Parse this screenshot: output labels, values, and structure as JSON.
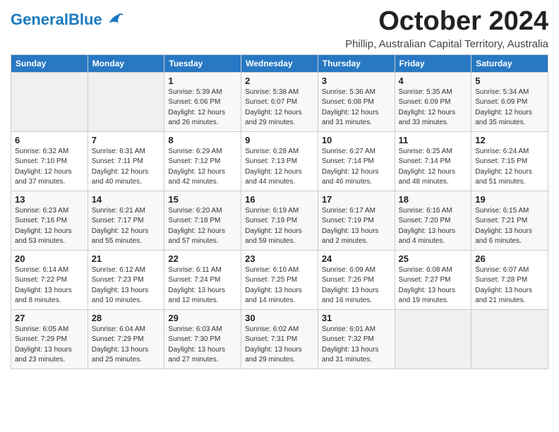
{
  "logo": {
    "text_general": "General",
    "text_blue": "Blue"
  },
  "title": "October 2024",
  "subtitle": "Phillip, Australian Capital Territory, Australia",
  "days_of_week": [
    "Sunday",
    "Monday",
    "Tuesday",
    "Wednesday",
    "Thursday",
    "Friday",
    "Saturday"
  ],
  "weeks": [
    [
      {
        "day": "",
        "sunrise": "",
        "sunset": "",
        "daylight": ""
      },
      {
        "day": "",
        "sunrise": "",
        "sunset": "",
        "daylight": ""
      },
      {
        "day": "1",
        "sunrise": "Sunrise: 5:39 AM",
        "sunset": "Sunset: 6:06 PM",
        "daylight": "Daylight: 12 hours and 26 minutes."
      },
      {
        "day": "2",
        "sunrise": "Sunrise: 5:38 AM",
        "sunset": "Sunset: 6:07 PM",
        "daylight": "Daylight: 12 hours and 29 minutes."
      },
      {
        "day": "3",
        "sunrise": "Sunrise: 5:36 AM",
        "sunset": "Sunset: 6:08 PM",
        "daylight": "Daylight: 12 hours and 31 minutes."
      },
      {
        "day": "4",
        "sunrise": "Sunrise: 5:35 AM",
        "sunset": "Sunset: 6:09 PM",
        "daylight": "Daylight: 12 hours and 33 minutes."
      },
      {
        "day": "5",
        "sunrise": "Sunrise: 5:34 AM",
        "sunset": "Sunset: 6:09 PM",
        "daylight": "Daylight: 12 hours and 35 minutes."
      }
    ],
    [
      {
        "day": "6",
        "sunrise": "Sunrise: 6:32 AM",
        "sunset": "Sunset: 7:10 PM",
        "daylight": "Daylight: 12 hours and 37 minutes."
      },
      {
        "day": "7",
        "sunrise": "Sunrise: 6:31 AM",
        "sunset": "Sunset: 7:11 PM",
        "daylight": "Daylight: 12 hours and 40 minutes."
      },
      {
        "day": "8",
        "sunrise": "Sunrise: 6:29 AM",
        "sunset": "Sunset: 7:12 PM",
        "daylight": "Daylight: 12 hours and 42 minutes."
      },
      {
        "day": "9",
        "sunrise": "Sunrise: 6:28 AM",
        "sunset": "Sunset: 7:13 PM",
        "daylight": "Daylight: 12 hours and 44 minutes."
      },
      {
        "day": "10",
        "sunrise": "Sunrise: 6:27 AM",
        "sunset": "Sunset: 7:14 PM",
        "daylight": "Daylight: 12 hours and 46 minutes."
      },
      {
        "day": "11",
        "sunrise": "Sunrise: 6:25 AM",
        "sunset": "Sunset: 7:14 PM",
        "daylight": "Daylight: 12 hours and 48 minutes."
      },
      {
        "day": "12",
        "sunrise": "Sunrise: 6:24 AM",
        "sunset": "Sunset: 7:15 PM",
        "daylight": "Daylight: 12 hours and 51 minutes."
      }
    ],
    [
      {
        "day": "13",
        "sunrise": "Sunrise: 6:23 AM",
        "sunset": "Sunset: 7:16 PM",
        "daylight": "Daylight: 12 hours and 53 minutes."
      },
      {
        "day": "14",
        "sunrise": "Sunrise: 6:21 AM",
        "sunset": "Sunset: 7:17 PM",
        "daylight": "Daylight: 12 hours and 55 minutes."
      },
      {
        "day": "15",
        "sunrise": "Sunrise: 6:20 AM",
        "sunset": "Sunset: 7:18 PM",
        "daylight": "Daylight: 12 hours and 57 minutes."
      },
      {
        "day": "16",
        "sunrise": "Sunrise: 6:19 AM",
        "sunset": "Sunset: 7:19 PM",
        "daylight": "Daylight: 12 hours and 59 minutes."
      },
      {
        "day": "17",
        "sunrise": "Sunrise: 6:17 AM",
        "sunset": "Sunset: 7:19 PM",
        "daylight": "Daylight: 13 hours and 2 minutes."
      },
      {
        "day": "18",
        "sunrise": "Sunrise: 6:16 AM",
        "sunset": "Sunset: 7:20 PM",
        "daylight": "Daylight: 13 hours and 4 minutes."
      },
      {
        "day": "19",
        "sunrise": "Sunrise: 6:15 AM",
        "sunset": "Sunset: 7:21 PM",
        "daylight": "Daylight: 13 hours and 6 minutes."
      }
    ],
    [
      {
        "day": "20",
        "sunrise": "Sunrise: 6:14 AM",
        "sunset": "Sunset: 7:22 PM",
        "daylight": "Daylight: 13 hours and 8 minutes."
      },
      {
        "day": "21",
        "sunrise": "Sunrise: 6:12 AM",
        "sunset": "Sunset: 7:23 PM",
        "daylight": "Daylight: 13 hours and 10 minutes."
      },
      {
        "day": "22",
        "sunrise": "Sunrise: 6:11 AM",
        "sunset": "Sunset: 7:24 PM",
        "daylight": "Daylight: 13 hours and 12 minutes."
      },
      {
        "day": "23",
        "sunrise": "Sunrise: 6:10 AM",
        "sunset": "Sunset: 7:25 PM",
        "daylight": "Daylight: 13 hours and 14 minutes."
      },
      {
        "day": "24",
        "sunrise": "Sunrise: 6:09 AM",
        "sunset": "Sunset: 7:26 PM",
        "daylight": "Daylight: 13 hours and 16 minutes."
      },
      {
        "day": "25",
        "sunrise": "Sunrise: 6:08 AM",
        "sunset": "Sunset: 7:27 PM",
        "daylight": "Daylight: 13 hours and 19 minutes."
      },
      {
        "day": "26",
        "sunrise": "Sunrise: 6:07 AM",
        "sunset": "Sunset: 7:28 PM",
        "daylight": "Daylight: 13 hours and 21 minutes."
      }
    ],
    [
      {
        "day": "27",
        "sunrise": "Sunrise: 6:05 AM",
        "sunset": "Sunset: 7:29 PM",
        "daylight": "Daylight: 13 hours and 23 minutes."
      },
      {
        "day": "28",
        "sunrise": "Sunrise: 6:04 AM",
        "sunset": "Sunset: 7:29 PM",
        "daylight": "Daylight: 13 hours and 25 minutes."
      },
      {
        "day": "29",
        "sunrise": "Sunrise: 6:03 AM",
        "sunset": "Sunset: 7:30 PM",
        "daylight": "Daylight: 13 hours and 27 minutes."
      },
      {
        "day": "30",
        "sunrise": "Sunrise: 6:02 AM",
        "sunset": "Sunset: 7:31 PM",
        "daylight": "Daylight: 13 hours and 29 minutes."
      },
      {
        "day": "31",
        "sunrise": "Sunrise: 6:01 AM",
        "sunset": "Sunset: 7:32 PM",
        "daylight": "Daylight: 13 hours and 31 minutes."
      },
      {
        "day": "",
        "sunrise": "",
        "sunset": "",
        "daylight": ""
      },
      {
        "day": "",
        "sunrise": "",
        "sunset": "",
        "daylight": ""
      }
    ]
  ]
}
